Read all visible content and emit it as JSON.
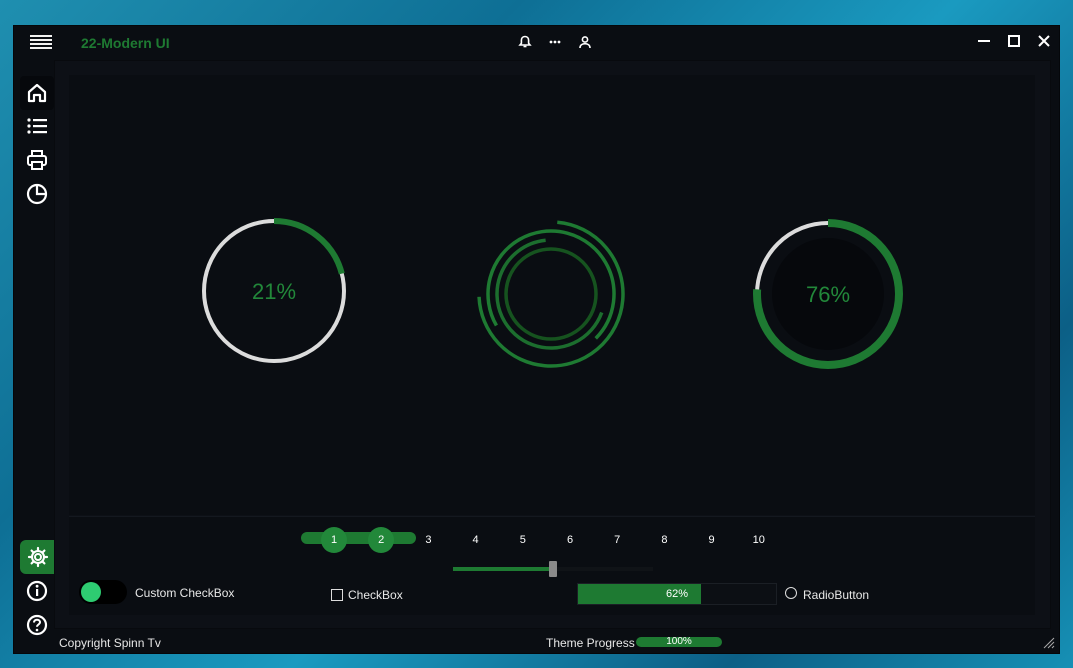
{
  "app": {
    "title": "22-Modern UI"
  },
  "titlebar_icons": [
    "bell-icon",
    "more-icon",
    "user-icon"
  ],
  "window_controls": [
    "minimize-icon",
    "maximize-icon",
    "close-icon"
  ],
  "sidebar": {
    "top_items": [
      "home-icon",
      "list-icon",
      "print-icon",
      "pie-chart-icon"
    ],
    "bottom_items": [
      "settings-icon",
      "info-icon",
      "help-icon"
    ],
    "selected": "settings-icon"
  },
  "gauges": {
    "left": {
      "value": 0.21,
      "label": "21%"
    },
    "center": {
      "type": "spinner"
    },
    "right": {
      "value": 0.76,
      "label": "76%"
    }
  },
  "pager": {
    "pages": [
      "1",
      "2",
      "3",
      "4",
      "5",
      "6",
      "7",
      "8",
      "9",
      "10"
    ],
    "active": [
      "1",
      "2"
    ]
  },
  "slider": {
    "value": 0.5
  },
  "controls": {
    "toggle_label": "Custom CheckBox",
    "toggle_on": true,
    "checkbox_label": "CheckBox",
    "checkbox_checked": false,
    "progress": {
      "value": 0.62,
      "label": "62%"
    },
    "radio_label": "RadioButton",
    "radio_checked": false
  },
  "status": {
    "copyright": "Copyright Spinn Tv",
    "theme_progress_label": "Theme Progress",
    "theme_progress": {
      "value": 1.0,
      "label": "100%"
    }
  },
  "colors": {
    "accent": "#1e7a32",
    "accent_text": "#22883a",
    "track": "#dcdcdc",
    "background": "#0a0d12"
  }
}
